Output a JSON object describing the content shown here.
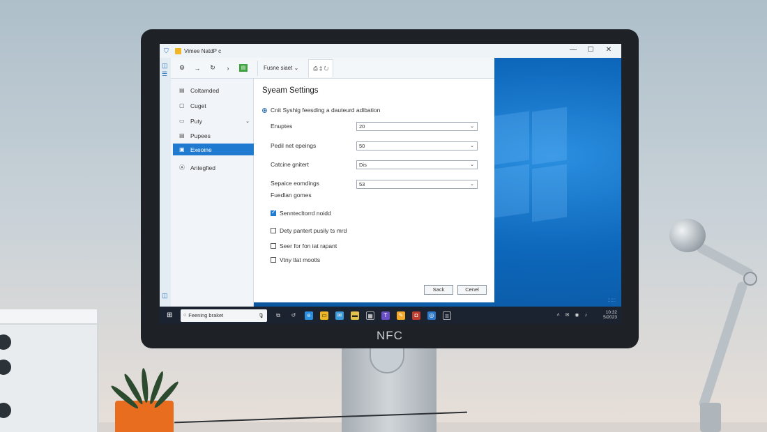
{
  "window": {
    "title": "Vimee NatdP c"
  },
  "toolbar": {
    "tab_label": "Fusne siaet",
    "tab_chevron": "⌄",
    "tab2_icons": "⎙ ‡ ↻"
  },
  "sidebar": {
    "items": [
      {
        "label": "Coltamded",
        "icon": "▤"
      },
      {
        "label": "Cuget",
        "icon": "▢"
      },
      {
        "label": "Puty",
        "icon": "▭",
        "chevron": "⌄"
      },
      {
        "label": "Pupees",
        "icon": "▤"
      },
      {
        "label": "Exeoine",
        "icon": "▣",
        "active": true
      },
      {
        "label": "Antegfied",
        "icon": "Ⓐ"
      }
    ]
  },
  "panel": {
    "title": "Syeam Settings",
    "radio_label": "Cnit Syshig feesding a dauteurd adibation",
    "fields": [
      {
        "label": "Enuptes",
        "value": "20"
      },
      {
        "label": "Pedil net epeings",
        "value": "50"
      },
      {
        "label": "Catcine gnitert",
        "value": "Dis"
      },
      {
        "label": "Sepaice eomdings",
        "value": "53"
      }
    ],
    "extra_label": "Fuedlan gomes",
    "checkboxes": [
      {
        "label": "Senntecltorrd noidd",
        "checked": true
      },
      {
        "label": "Dety pantert pusily ts mrd",
        "checked": false
      },
      {
        "label": "Seer for fon iat rapant",
        "checked": false
      },
      {
        "label": "Vtny tlat mootls",
        "checked": false
      }
    ],
    "save_label": "Sack",
    "cancel_label": "Cenel"
  },
  "taskbar": {
    "search_placeholder": "Feening braket",
    "clock_time": "10:32",
    "clock_date": "5/2023"
  },
  "monitor": {
    "brand": "NFC"
  },
  "colors": {
    "accent": "#1f7ad0",
    "taskbar": "#1b2330",
    "desktop": "#0d67bb"
  }
}
